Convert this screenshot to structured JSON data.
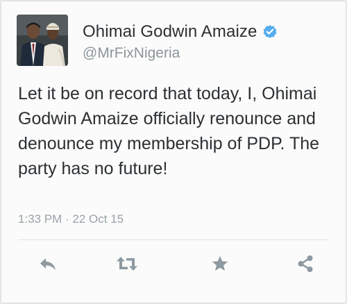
{
  "tweet": {
    "author": {
      "display_name": "Ohimai Godwin Amaize",
      "handle": "@MrFixNigeria",
      "verified": true
    },
    "text": "Let it be on record that today, I, Ohimai Godwin Amaize officially renounce and denounce my membership of PDP. The party has no future!",
    "timestamp": "1:33 PM · 22 Oct 15"
  },
  "actions": [
    {
      "name": "reply",
      "icon": "reply-icon"
    },
    {
      "name": "retweet",
      "icon": "retweet-icon"
    },
    {
      "name": "favorite",
      "icon": "star-icon"
    },
    {
      "name": "share",
      "icon": "share-icon"
    }
  ],
  "colors": {
    "text": "#2c2f33",
    "muted": "#8d969c",
    "icon": "#8e99a1",
    "verified_badge": "#55acee",
    "card_bg": "#fafbfa"
  }
}
